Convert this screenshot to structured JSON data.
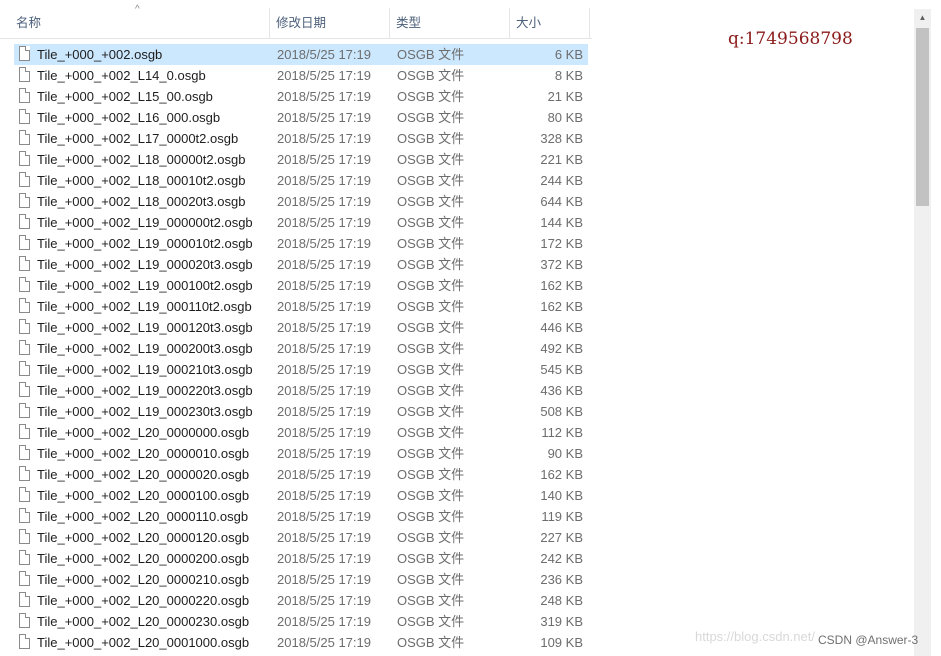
{
  "columns": {
    "name": "名称",
    "date": "修改日期",
    "type": "类型",
    "size": "大小"
  },
  "files": [
    {
      "name": "Tile_+000_+002.osgb",
      "date": "2018/5/25 17:19",
      "type": "OSGB 文件",
      "size": "6 KB"
    },
    {
      "name": "Tile_+000_+002_L14_0.osgb",
      "date": "2018/5/25 17:19",
      "type": "OSGB 文件",
      "size": "8 KB"
    },
    {
      "name": "Tile_+000_+002_L15_00.osgb",
      "date": "2018/5/25 17:19",
      "type": "OSGB 文件",
      "size": "21 KB"
    },
    {
      "name": "Tile_+000_+002_L16_000.osgb",
      "date": "2018/5/25 17:19",
      "type": "OSGB 文件",
      "size": "80 KB"
    },
    {
      "name": "Tile_+000_+002_L17_0000t2.osgb",
      "date": "2018/5/25 17:19",
      "type": "OSGB 文件",
      "size": "328 KB"
    },
    {
      "name": "Tile_+000_+002_L18_00000t2.osgb",
      "date": "2018/5/25 17:19",
      "type": "OSGB 文件",
      "size": "221 KB"
    },
    {
      "name": "Tile_+000_+002_L18_00010t2.osgb",
      "date": "2018/5/25 17:19",
      "type": "OSGB 文件",
      "size": "244 KB"
    },
    {
      "name": "Tile_+000_+002_L18_00020t3.osgb",
      "date": "2018/5/25 17:19",
      "type": "OSGB 文件",
      "size": "644 KB"
    },
    {
      "name": "Tile_+000_+002_L19_000000t2.osgb",
      "date": "2018/5/25 17:19",
      "type": "OSGB 文件",
      "size": "144 KB"
    },
    {
      "name": "Tile_+000_+002_L19_000010t2.osgb",
      "date": "2018/5/25 17:19",
      "type": "OSGB 文件",
      "size": "172 KB"
    },
    {
      "name": "Tile_+000_+002_L19_000020t3.osgb",
      "date": "2018/5/25 17:19",
      "type": "OSGB 文件",
      "size": "372 KB"
    },
    {
      "name": "Tile_+000_+002_L19_000100t2.osgb",
      "date": "2018/5/25 17:19",
      "type": "OSGB 文件",
      "size": "162 KB"
    },
    {
      "name": "Tile_+000_+002_L19_000110t2.osgb",
      "date": "2018/5/25 17:19",
      "type": "OSGB 文件",
      "size": "162 KB"
    },
    {
      "name": "Tile_+000_+002_L19_000120t3.osgb",
      "date": "2018/5/25 17:19",
      "type": "OSGB 文件",
      "size": "446 KB"
    },
    {
      "name": "Tile_+000_+002_L19_000200t3.osgb",
      "date": "2018/5/25 17:19",
      "type": "OSGB 文件",
      "size": "492 KB"
    },
    {
      "name": "Tile_+000_+002_L19_000210t3.osgb",
      "date": "2018/5/25 17:19",
      "type": "OSGB 文件",
      "size": "545 KB"
    },
    {
      "name": "Tile_+000_+002_L19_000220t3.osgb",
      "date": "2018/5/25 17:19",
      "type": "OSGB 文件",
      "size": "436 KB"
    },
    {
      "name": "Tile_+000_+002_L19_000230t3.osgb",
      "date": "2018/5/25 17:19",
      "type": "OSGB 文件",
      "size": "508 KB"
    },
    {
      "name": "Tile_+000_+002_L20_0000000.osgb",
      "date": "2018/5/25 17:19",
      "type": "OSGB 文件",
      "size": "112 KB"
    },
    {
      "name": "Tile_+000_+002_L20_0000010.osgb",
      "date": "2018/5/25 17:19",
      "type": "OSGB 文件",
      "size": "90 KB"
    },
    {
      "name": "Tile_+000_+002_L20_0000020.osgb",
      "date": "2018/5/25 17:19",
      "type": "OSGB 文件",
      "size": "162 KB"
    },
    {
      "name": "Tile_+000_+002_L20_0000100.osgb",
      "date": "2018/5/25 17:19",
      "type": "OSGB 文件",
      "size": "140 KB"
    },
    {
      "name": "Tile_+000_+002_L20_0000110.osgb",
      "date": "2018/5/25 17:19",
      "type": "OSGB 文件",
      "size": "119 KB"
    },
    {
      "name": "Tile_+000_+002_L20_0000120.osgb",
      "date": "2018/5/25 17:19",
      "type": "OSGB 文件",
      "size": "227 KB"
    },
    {
      "name": "Tile_+000_+002_L20_0000200.osgb",
      "date": "2018/5/25 17:19",
      "type": "OSGB 文件",
      "size": "242 KB"
    },
    {
      "name": "Tile_+000_+002_L20_0000210.osgb",
      "date": "2018/5/25 17:19",
      "type": "OSGB 文件",
      "size": "236 KB"
    },
    {
      "name": "Tile_+000_+002_L20_0000220.osgb",
      "date": "2018/5/25 17:19",
      "type": "OSGB 文件",
      "size": "248 KB"
    },
    {
      "name": "Tile_+000_+002_L20_0000230.osgb",
      "date": "2018/5/25 17:19",
      "type": "OSGB 文件",
      "size": "319 KB"
    },
    {
      "name": "Tile_+000_+002_L20_0001000.osgb",
      "date": "2018/5/25 17:19",
      "type": "OSGB 文件",
      "size": "109 KB"
    }
  ],
  "selected_index": 0,
  "annotation": "q:1749568798",
  "watermark": "https://blog.csdn.net/",
  "credit": "CSDN @Answer-3",
  "icons": {
    "file": "file-icon",
    "sort": "sort-ascending-icon",
    "scroll_up": "scroll-up-arrow-icon"
  }
}
